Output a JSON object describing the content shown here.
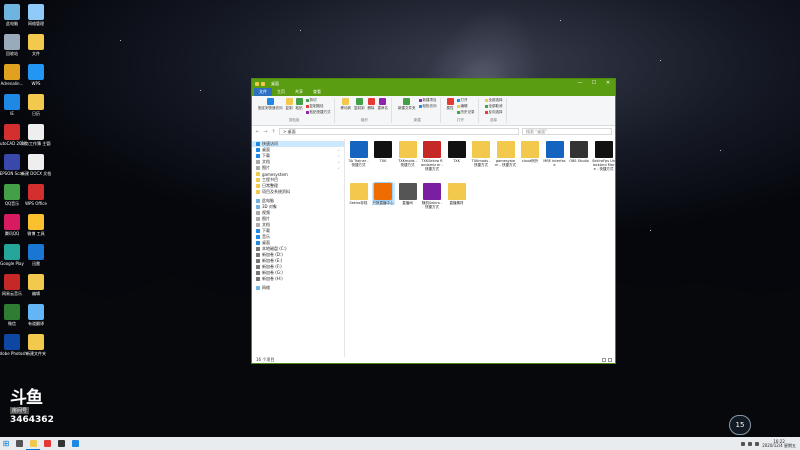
{
  "desktop": {
    "icons": [
      {
        "label": "此电脑",
        "color": "#6fb3e0"
      },
      {
        "label": "回收站",
        "color": "#9ab"
      },
      {
        "label": "Adrenalin...",
        "color": "#e0a020"
      },
      {
        "label": "IE",
        "color": "#1e88e5"
      },
      {
        "label": "AutoCAD 2014",
        "color": "#d32f2f"
      },
      {
        "label": "EPSON Scan",
        "color": "#3949ab"
      },
      {
        "label": "QQ音乐",
        "color": "#43a047"
      },
      {
        "label": "腾讯QQ",
        "color": "#d81b60"
      },
      {
        "label": "Google Play",
        "color": "#26a69a"
      },
      {
        "label": "网易云音乐",
        "color": "#c62828"
      },
      {
        "label": "微信",
        "color": "#2e7d32"
      },
      {
        "label": "Adobe Photosh...",
        "color": "#0d47a1"
      },
      {
        "label": "网络管理",
        "color": "#90caf9"
      },
      {
        "label": "文件",
        "color": "#f2c94c"
      },
      {
        "label": "WPS",
        "color": "#2196f3"
      },
      {
        "label": "日历",
        "color": "#f2c94c"
      },
      {
        "label": "财务工作簿 主管理器",
        "color": "#eeeeee"
      },
      {
        "label": "新建 DOCX 文档",
        "color": "#eeeeee"
      },
      {
        "label": "WPS Office",
        "color": "#d32f2f"
      },
      {
        "label": "微博 工具",
        "color": "#fbc02d"
      },
      {
        "label": "迅雷",
        "color": "#1976d2"
      },
      {
        "label": "编辑",
        "color": "#f2c94c"
      },
      {
        "label": "有道翻译",
        "color": "#64b5f6"
      },
      {
        "label": "新建文件夹",
        "color": "#f2c94c"
      }
    ]
  },
  "window": {
    "title": "桌面",
    "ribbon_tabs": [
      "文件",
      "主页",
      "共享",
      "查看"
    ],
    "window_controls": {
      "minimize": "—",
      "maximize": "☐",
      "close": "✕"
    },
    "ribbon_groups": [
      {
        "name": "剪贴板",
        "buttons": [
          "固定到快速访问",
          "复制",
          "粘贴"
        ],
        "small": [
          "剪切",
          "复制路径",
          "粘贴快捷方式"
        ]
      },
      {
        "name": "组织",
        "buttons": [
          "移动到",
          "复制到",
          "删除",
          "重命名"
        ],
        "small": []
      },
      {
        "name": "新建",
        "buttons": [
          "新建文件夹"
        ],
        "small": [
          "新建项目",
          "轻松访问"
        ]
      },
      {
        "name": "打开",
        "buttons": [
          "属性"
        ],
        "small": [
          "打开",
          "编辑",
          "历史记录"
        ]
      },
      {
        "name": "选择",
        "buttons": [],
        "small": [
          "全部选择",
          "全部取消",
          "反向选择"
        ]
      }
    ],
    "address": {
      "path": "> 桌面",
      "search_placeholder": "搜索 \"桌面\""
    },
    "nav_pane": [
      {
        "label": "快速访问",
        "color": "#1e88e5",
        "selected": true,
        "pinned": false
      },
      {
        "label": "桌面",
        "color": "#1e88e5",
        "selected": false,
        "pinned": true
      },
      {
        "label": "下载",
        "color": "#1e88e5",
        "selected": false,
        "pinned": true
      },
      {
        "label": "文档",
        "color": "#aaaaaa",
        "selected": false,
        "pinned": true
      },
      {
        "label": "图片",
        "color": "#aaaaaa",
        "selected": false,
        "pinned": true
      },
      {
        "label": "gamesystem",
        "color": "#f2c94c",
        "selected": false,
        "pinned": false
      },
      {
        "label": "工程书目",
        "color": "#f2c94c",
        "selected": false,
        "pinned": false
      },
      {
        "label": "日常整理",
        "color": "#f2c94c",
        "selected": false,
        "pinned": false
      },
      {
        "label": "项目及系统资料",
        "color": "#f2c94c",
        "selected": false,
        "pinned": false
      },
      {
        "label": "",
        "gap": true
      },
      {
        "label": "此电脑",
        "color": "#6fb3e0",
        "selected": false,
        "pinned": false
      },
      {
        "label": "3D 对象",
        "color": "#6fb3e0",
        "selected": false,
        "pinned": false
      },
      {
        "label": "视频",
        "color": "#aaaaaa",
        "selected": false,
        "pinned": false
      },
      {
        "label": "图片",
        "color": "#aaaaaa",
        "selected": false,
        "pinned": false
      },
      {
        "label": "文档",
        "color": "#aaaaaa",
        "selected": false,
        "pinned": false
      },
      {
        "label": "下载",
        "color": "#1e88e5",
        "selected": false,
        "pinned": false
      },
      {
        "label": "音乐",
        "color": "#1e88e5",
        "selected": false,
        "pinned": false
      },
      {
        "label": "桌面",
        "color": "#1e88e5",
        "selected": false,
        "pinned": false
      },
      {
        "label": "本地磁盘 (C:)",
        "color": "#777777",
        "selected": false,
        "pinned": false
      },
      {
        "label": "新加卷 (D:)",
        "color": "#777777",
        "selected": false,
        "pinned": false
      },
      {
        "label": "新加卷 (E:)",
        "color": "#777777",
        "selected": false,
        "pinned": false
      },
      {
        "label": "新加卷 (F:)",
        "color": "#777777",
        "selected": false,
        "pinned": false
      },
      {
        "label": "新加卷 (G:)",
        "color": "#777777",
        "selected": false,
        "pinned": false
      },
      {
        "label": "新加卷 (H:)",
        "color": "#777777",
        "selected": false,
        "pinned": false
      },
      {
        "label": "",
        "gap": true
      },
      {
        "label": "网络",
        "color": "#6fb3e0",
        "selected": false,
        "pinned": false
      }
    ],
    "files": [
      {
        "label": "3A Trainer - 快捷方式",
        "color": "#1565c0"
      },
      {
        "label": "TXK",
        "color": "#111111"
      },
      {
        "label": "TXKmods - 快捷方式",
        "color": "#f2c94c"
      },
      {
        "label": "TXKSekiro Randomiz er - 快捷方式",
        "color": "#c62828"
      },
      {
        "label": "TXK",
        "color": "#111111"
      },
      {
        "label": "TXKmods - 快捷方式",
        "color": "#f2c94c"
      },
      {
        "label": "gamesyste m - 快捷方式",
        "color": "#f2c94c"
      },
      {
        "label": "cloud例外",
        "color": "#f2c94c"
      },
      {
        "label": "MRE Interface",
        "color": "#1565c0"
      },
      {
        "label": "OBS Studio",
        "color": "#333333"
      },
      {
        "label": "SekiroFps UnlockAnd More - 快捷方式",
        "color": "#111111"
      },
      {
        "label": "Sekiro存档",
        "color": "#f2c94c"
      },
      {
        "label": "只狼直播中心",
        "color": "#ef6c00"
      },
      {
        "label": "直播间",
        "color": "#555555"
      },
      {
        "label": "随机Sekiro - 快捷方式",
        "color": "#7b1fa2"
      },
      {
        "label": "直播素材",
        "color": "#f2c94c"
      }
    ],
    "status": "16 个项目"
  },
  "overlay": {
    "brand": "斗鱼",
    "room_label": "房间号",
    "room_number": "3464362",
    "net_badge": "15"
  },
  "taskbar": {
    "apps": [
      {
        "name": "search",
        "color": "#555555"
      },
      {
        "name": "explorer",
        "color": "#f2c94c"
      },
      {
        "name": "chrome",
        "color": "#e53935"
      },
      {
        "name": "obs",
        "color": "#333333"
      },
      {
        "name": "qq",
        "color": "#1e88e5"
      }
    ],
    "time": "16:22",
    "date": "2020/12/4 星期五"
  }
}
